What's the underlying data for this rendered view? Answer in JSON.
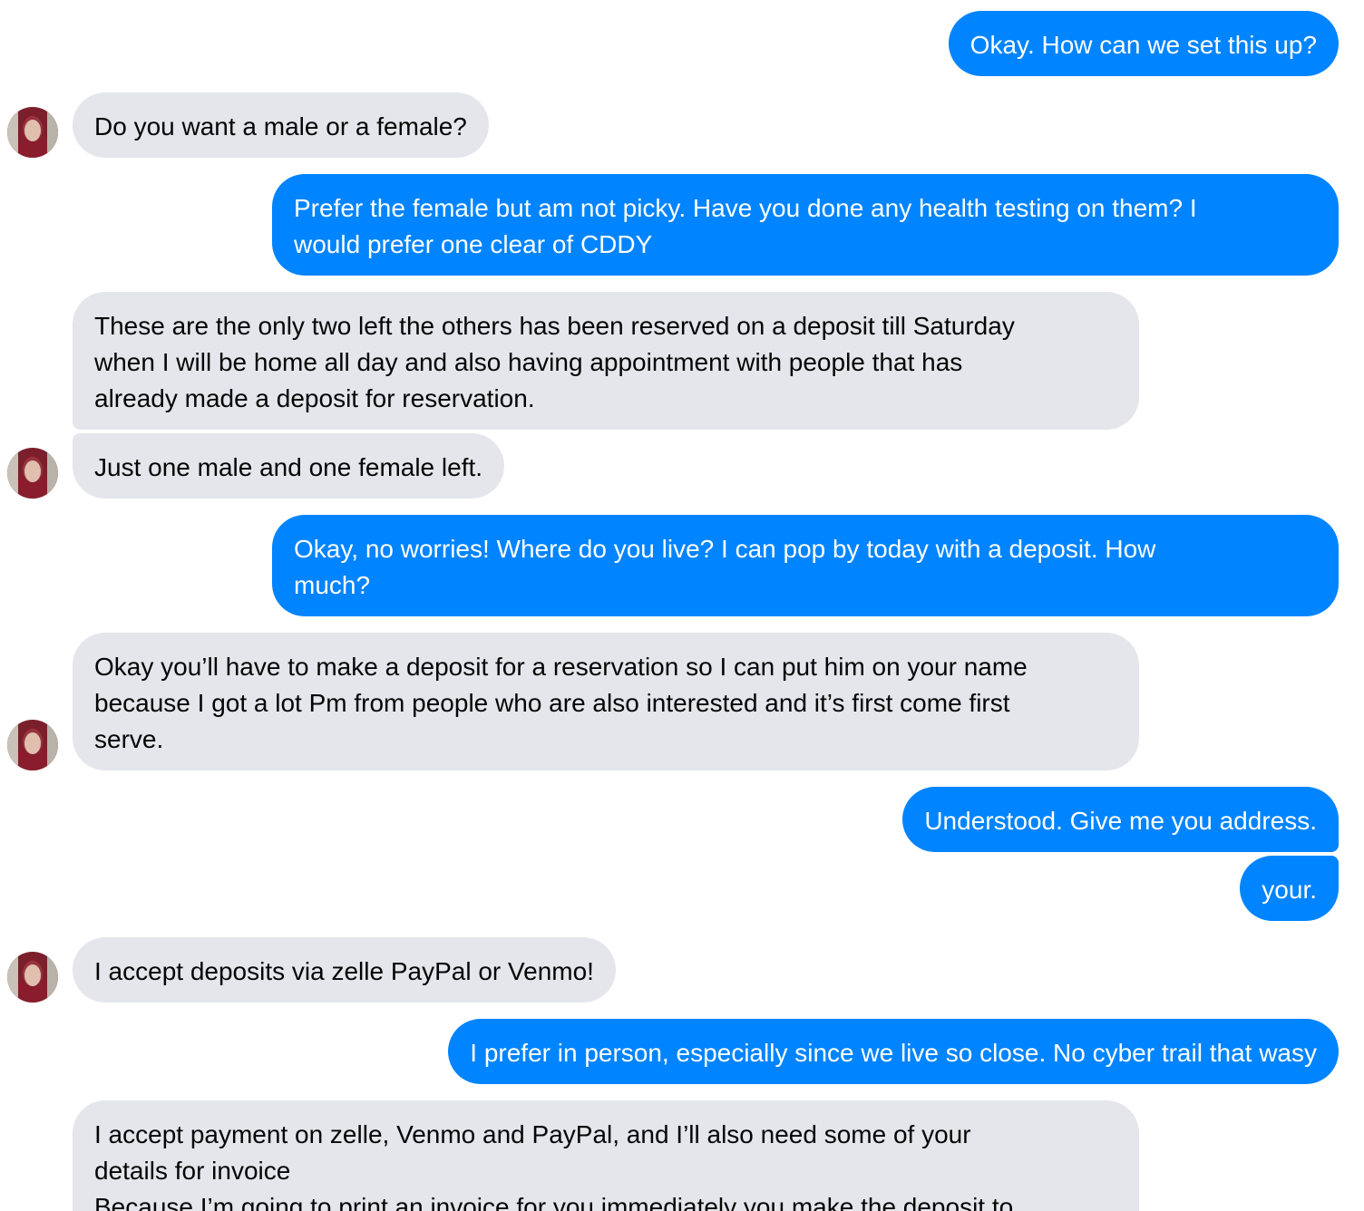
{
  "conversation": {
    "messages": [
      {
        "sender": "me",
        "text": "Okay. How can we set this up?"
      },
      {
        "sender": "contact",
        "text": "Do you want a male or a female?"
      },
      {
        "sender": "me",
        "text": "Prefer the female but am not picky. Have you done any health testing on them? I\nwould prefer one clear of CDDY"
      },
      {
        "sender": "contact",
        "text": "These are the only two left the others has been reserved on a deposit till Saturday\nwhen I will be home all day and also having appointment with people that has\nalready made a deposit for reservation."
      },
      {
        "sender": "contact",
        "text": "Just one male and one female left."
      },
      {
        "sender": "me",
        "text": "Okay, no worries! Where do you live? I can pop by today with a deposit. How\nmuch?"
      },
      {
        "sender": "contact",
        "text": "Okay you’ll have to make a deposit for a reservation so I can put him on your name\nbecause I got a lot Pm from people who are also interested and it’s first come first\nserve."
      },
      {
        "sender": "me",
        "text": "Understood. Give me you address."
      },
      {
        "sender": "me",
        "text": "your."
      },
      {
        "sender": "contact",
        "text": "I accept deposits via zelle PayPal or Venmo!"
      },
      {
        "sender": "me",
        "text": "I prefer in person, especially since we live so close. No cyber trail that wasy"
      },
      {
        "sender": "contact",
        "text": "I accept payment on zelle, Venmo and PayPal, and I’ll also need some of your\ndetails for invoice\nBecause I’m going to print an invoice for you immediately you make the deposit to"
      }
    ]
  },
  "colors": {
    "outgoing_bubble": "#0084ff",
    "incoming_bubble": "#e4e6eb",
    "outgoing_text": "#ffffff",
    "incoming_text": "#050505"
  },
  "icons": {
    "avatar": "contact-avatar-photo"
  }
}
